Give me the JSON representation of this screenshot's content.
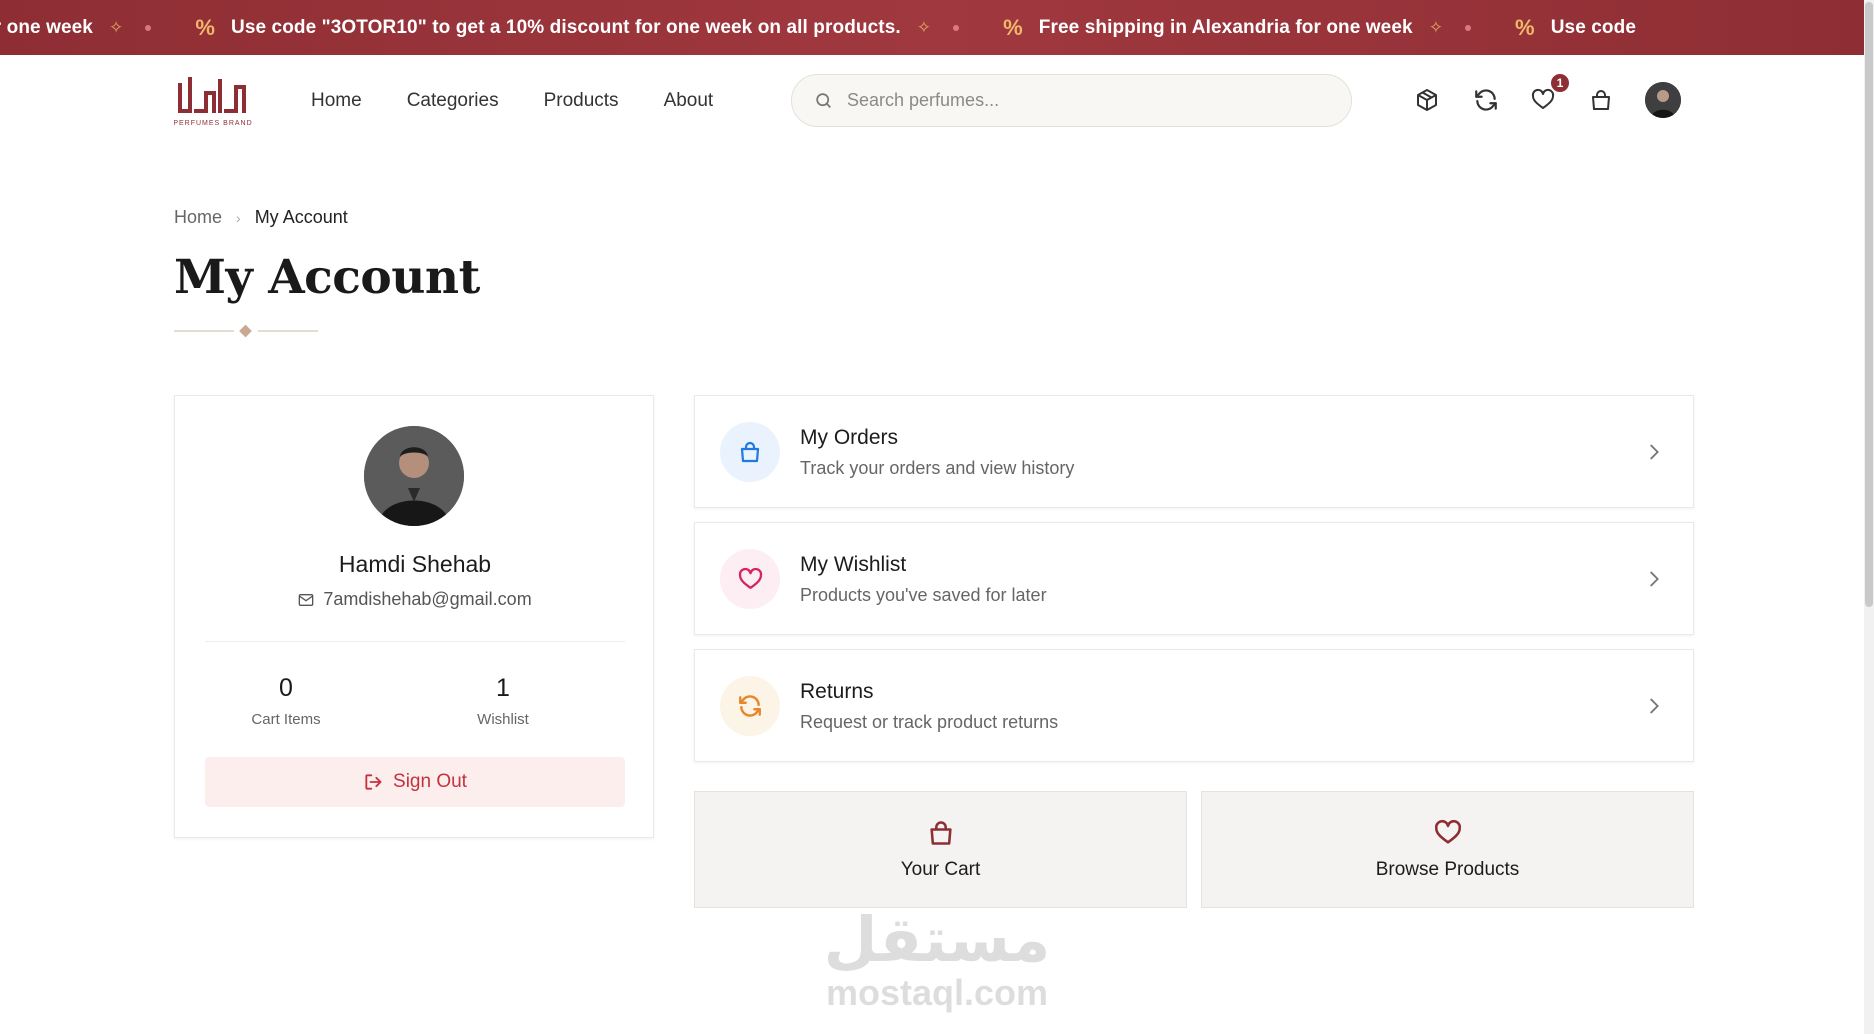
{
  "promo": {
    "items": [
      "dria for one week",
      "Use code \"3OTOR10\" to get a 10% discount for one week on all products.",
      "Free shipping in Alexandria for one week",
      "Use code"
    ],
    "percent_symbol": "%"
  },
  "header": {
    "logo_alt": "3OTOR PERFUMES BRAND",
    "nav": [
      "Home",
      "Categories",
      "Products",
      "About"
    ],
    "search_placeholder": "Search perfumes...",
    "wishlist_count": "1"
  },
  "breadcrumb": {
    "home": "Home",
    "current": "My Account"
  },
  "page": {
    "title": "My Account"
  },
  "profile": {
    "name": "Hamdi Shehab",
    "email": "7amdishehab@gmail.com",
    "stats": [
      {
        "value": "0",
        "label": "Cart Items"
      },
      {
        "value": "1",
        "label": "Wishlist"
      }
    ],
    "signout_label": "Sign Out"
  },
  "menu": [
    {
      "title": "My Orders",
      "subtitle": "Track your orders and view history",
      "icon": "shopping-bag-icon",
      "color": "#1e7ae0",
      "bg": "#eaf3fd"
    },
    {
      "title": "My Wishlist",
      "subtitle": "Products you've saved for later",
      "icon": "heart-icon",
      "color": "#d6245c",
      "bg": "#fdeef3"
    },
    {
      "title": "Returns",
      "subtitle": "Request or track product returns",
      "icon": "refresh-icon",
      "color": "#e8872a",
      "bg": "#fdf4e8"
    }
  ],
  "quick_actions": [
    {
      "label": "Your Cart",
      "icon": "shopping-bag-icon"
    },
    {
      "label": "Browse Products",
      "icon": "heart-icon"
    }
  ],
  "watermark": {
    "arabic": "مستقل",
    "latin": "mostaql.com"
  },
  "colors": {
    "brand": "#8e2e34",
    "promo_accent": "#f1b76c",
    "signout_text": "#c4323e",
    "signout_bg": "#fdeeee"
  }
}
